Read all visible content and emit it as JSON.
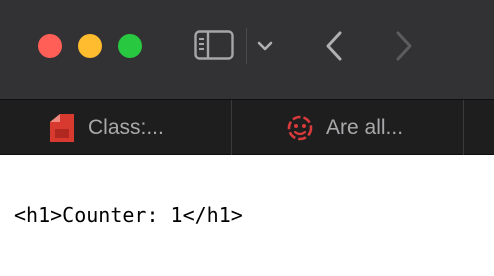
{
  "window": {
    "controls": [
      "close",
      "minimize",
      "maximize"
    ],
    "colors": {
      "close": "#ff5f57",
      "minimize": "#febc2e",
      "maximize": "#28c840"
    }
  },
  "toolbar": {
    "icons": [
      "sidebar-icon",
      "chevron-down-icon",
      "back-arrow-icon",
      "forward-arrow-icon"
    ]
  },
  "tabs": [
    {
      "label": "Class:...",
      "icon": "red-document-icon",
      "icon_color": "#d93a2f"
    },
    {
      "label": "Are all...",
      "icon": "red-face-badge-icon",
      "icon_color": "#d93a3a"
    }
  ],
  "content": {
    "text": "<h1>Counter: 1</h1>"
  }
}
